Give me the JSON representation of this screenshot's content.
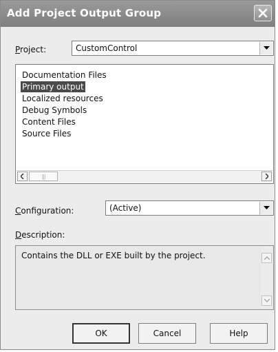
{
  "dialog": {
    "title": "Add Project Output Group"
  },
  "project": {
    "label_mnemonic": "P",
    "label_rest": "roject:",
    "value": "CustomControl"
  },
  "outputs": {
    "items": [
      "Documentation Files",
      "Primary output",
      "Localized resources",
      "Debug Symbols",
      "Content Files",
      "Source Files"
    ],
    "selected": "Primary output"
  },
  "configuration": {
    "label_mnemonic": "C",
    "label_rest": "onfiguration:",
    "value": "(Active)"
  },
  "description": {
    "label_mnemonic": "D",
    "label_rest": "escription:",
    "text": "Contains the DLL or EXE built by the project."
  },
  "buttons": {
    "ok": "OK",
    "cancel": "Cancel",
    "help": "Help"
  },
  "icons": [
    "close-icon",
    "dropdown-arrow-icon",
    "scroll-left-icon",
    "scroll-right-icon",
    "scroll-up-icon",
    "scroll-down-icon"
  ]
}
